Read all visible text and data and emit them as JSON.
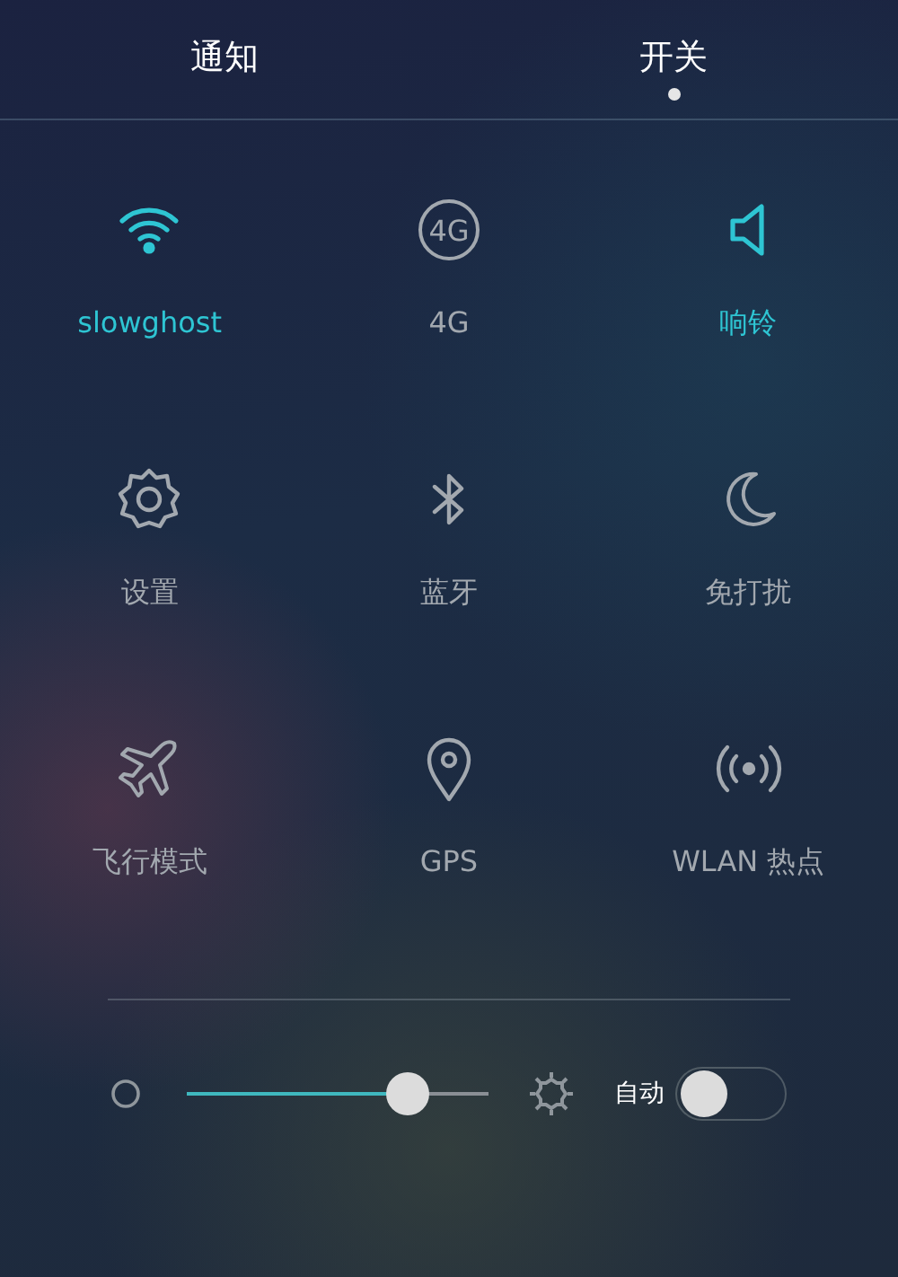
{
  "tabs": [
    {
      "label": "通知",
      "selected": false
    },
    {
      "label": "开关",
      "selected": true
    }
  ],
  "toggles": [
    {
      "kind": "wifi",
      "label": "slowghost",
      "on": true
    },
    {
      "kind": "mobile-data",
      "label": "4G",
      "on": false
    },
    {
      "kind": "speaker",
      "label": "响铃",
      "on": true
    },
    {
      "kind": "gear",
      "label": "设置",
      "on": false
    },
    {
      "kind": "bluetooth",
      "label": "蓝牙",
      "on": false
    },
    {
      "kind": "moon",
      "label": "免打扰",
      "on": false
    },
    {
      "kind": "airplane",
      "label": "飞行模式",
      "on": false
    },
    {
      "kind": "pin",
      "label": "GPS",
      "on": false
    },
    {
      "kind": "hotspot",
      "label": "WLAN 热点",
      "on": false
    }
  ],
  "mobile_data_icon_text": "4G",
  "brightness": {
    "level": 0.73,
    "auto_label": "自动",
    "auto_on": false
  }
}
